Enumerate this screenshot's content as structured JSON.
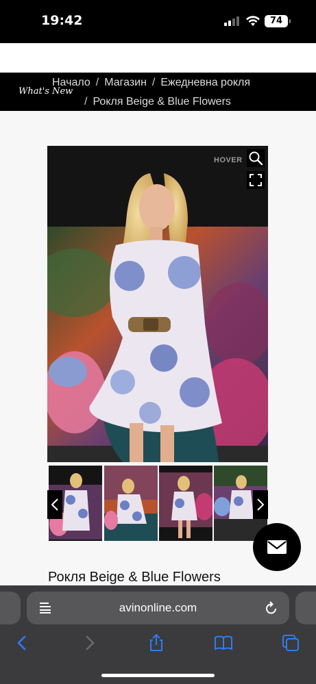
{
  "status_bar": {
    "time": "19:42",
    "battery": "74"
  },
  "breadcrumb": {
    "logo_text": "What's New",
    "home": "Начало",
    "shop": "Магазин",
    "category": "Ежедневна рокля",
    "current": "Рокля Beige & Blue Flowers",
    "separator": "/"
  },
  "gallery": {
    "hover_label": "HOVER",
    "zoom_icon": "magnifier-icon",
    "fullscreen_icon": "fullscreen-icon",
    "thumbnails_count": 4,
    "prev_icon": "chevron-left-icon",
    "next_icon": "chevron-right-icon"
  },
  "product": {
    "title": "Рокля Beige & Blue Flowers"
  },
  "fab": {
    "icon": "mail-icon"
  },
  "browser": {
    "url": "avinonline.com",
    "toolbar": [
      "back-icon",
      "forward-icon",
      "share-icon",
      "bookmarks-icon",
      "tabs-icon"
    ]
  },
  "colors": {
    "accent_blue": "#2f7cf6",
    "bar_black": "#000000",
    "safari_bar": "#3b3b3d"
  }
}
